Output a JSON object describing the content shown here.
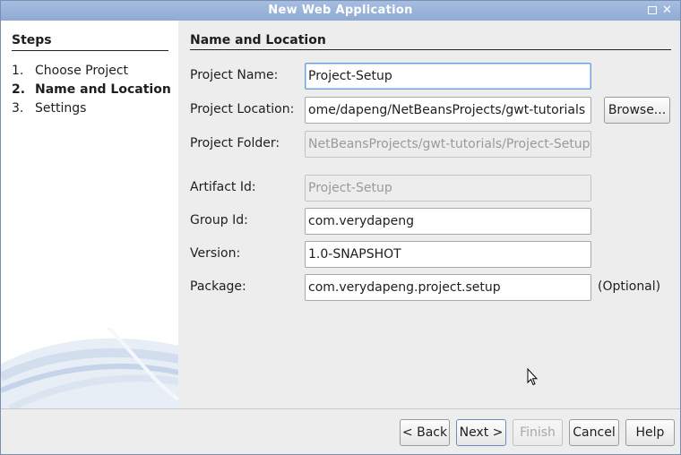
{
  "window": {
    "title": "New Web Application"
  },
  "steps": {
    "heading": "Steps",
    "items": [
      {
        "num": "1.",
        "label": "Choose Project"
      },
      {
        "num": "2.",
        "label": "Name and Location"
      },
      {
        "num": "3.",
        "label": "Settings"
      }
    ],
    "current_index": 1
  },
  "content": {
    "title": "Name and Location",
    "project_name": {
      "label": "Project Name:",
      "value": "Project-Setup"
    },
    "project_location": {
      "label": "Project Location:",
      "value": "ome/dapeng/NetBeansProjects/gwt-tutorials"
    },
    "project_folder": {
      "label": "Project Folder:",
      "value": "NetBeansProjects/gwt-tutorials/Project-Setup"
    },
    "artifact_id": {
      "label": "Artifact Id:",
      "value": "Project-Setup"
    },
    "group_id": {
      "label": "Group Id:",
      "value": "com.verydapeng"
    },
    "version": {
      "label": "Version:",
      "value": "1.0-SNAPSHOT"
    },
    "package": {
      "label": "Package:",
      "value": "com.verydapeng.project.setup",
      "hint": "(Optional)"
    },
    "browse_label": "Browse..."
  },
  "buttons": {
    "back": "< Back",
    "next": "Next >",
    "finish": "Finish",
    "cancel": "Cancel",
    "help": "Help"
  },
  "icons": {
    "maximize": "maximize-icon",
    "close": "close-icon",
    "cursor": "mouse-pointer-icon"
  },
  "colors": {
    "titlebar": "#9bb3d9",
    "focus_border": "#6f9fd8"
  }
}
